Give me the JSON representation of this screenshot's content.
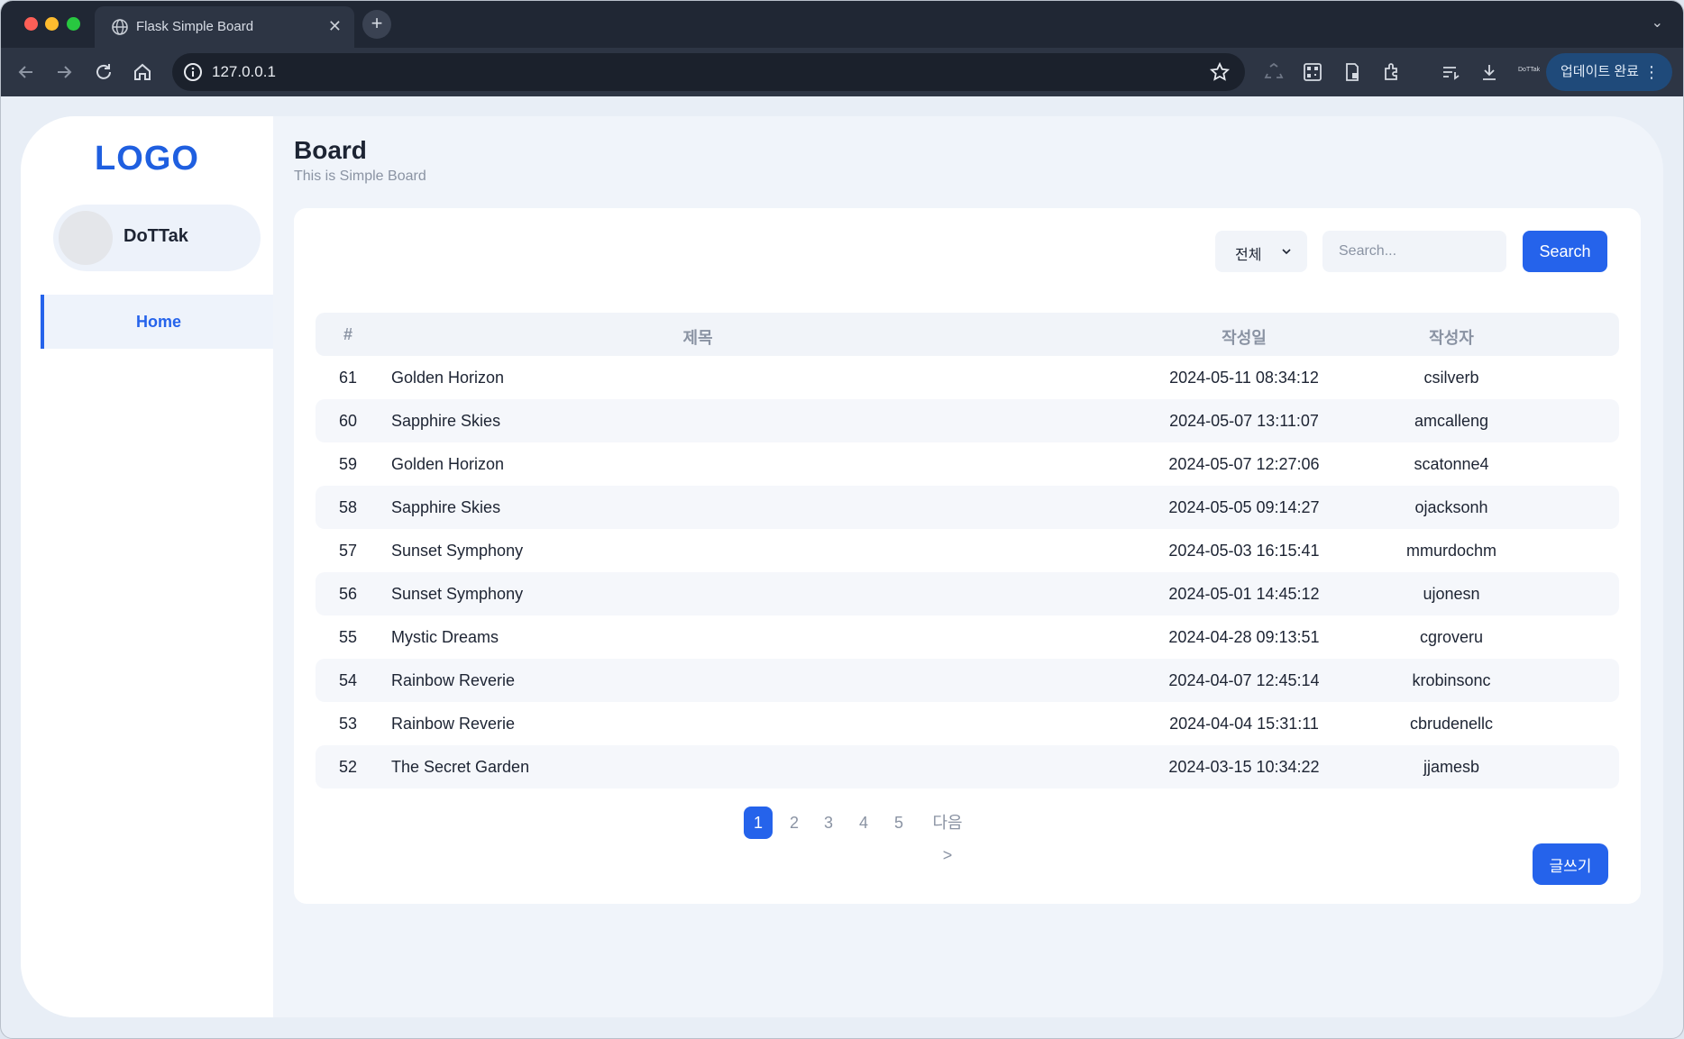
{
  "browser": {
    "tab_title": "Flask Simple Board",
    "url": "127.0.0.1",
    "update_label": "업데이트 완료",
    "extension_label": "DoTTak"
  },
  "sidebar": {
    "logo": "LOGO",
    "profile_name": "DoTTak",
    "nav": [
      {
        "label": "Home"
      }
    ]
  },
  "header": {
    "title": "Board",
    "subtitle": "This is Simple Board"
  },
  "filter": {
    "selected": "전체",
    "search_placeholder": "Search...",
    "search_label": "Search"
  },
  "table": {
    "columns": [
      "#",
      "제목",
      "작성일",
      "작성자"
    ],
    "rows": [
      {
        "num": "61",
        "title": "Golden Horizon",
        "date": "2024-05-11 08:34:12",
        "author": "csilverb"
      },
      {
        "num": "60",
        "title": "Sapphire Skies",
        "date": "2024-05-07 13:11:07",
        "author": "amcalleng"
      },
      {
        "num": "59",
        "title": "Golden Horizon",
        "date": "2024-05-07 12:27:06",
        "author": "scatonne4"
      },
      {
        "num": "58",
        "title": "Sapphire Skies",
        "date": "2024-05-05 09:14:27",
        "author": "ojacksonh"
      },
      {
        "num": "57",
        "title": "Sunset Symphony",
        "date": "2024-05-03 16:15:41",
        "author": "mmurdochm"
      },
      {
        "num": "56",
        "title": "Sunset Symphony",
        "date": "2024-05-01 14:45:12",
        "author": "ujonesn"
      },
      {
        "num": "55",
        "title": "Mystic Dreams",
        "date": "2024-04-28 09:13:51",
        "author": "cgroveru"
      },
      {
        "num": "54",
        "title": "Rainbow Reverie",
        "date": "2024-04-07 12:45:14",
        "author": "krobinsonc"
      },
      {
        "num": "53",
        "title": "Rainbow Reverie",
        "date": "2024-04-04 15:31:11",
        "author": "cbrudenellc"
      },
      {
        "num": "52",
        "title": "The Secret Garden",
        "date": "2024-03-15 10:34:22",
        "author": "jjamesb"
      }
    ]
  },
  "pagination": {
    "pages": [
      "1",
      "2",
      "3",
      "4",
      "5"
    ],
    "current": "1",
    "next_label": "다음 >"
  },
  "write_label": "글쓰기",
  "colors": {
    "accent": "#2563eb",
    "chrome_dark": "#202734",
    "page_bg": "#f0f4fa"
  },
  "icons": [
    "globe-icon",
    "close-icon",
    "plus-icon",
    "back-icon",
    "forward-icon",
    "reload-icon",
    "home-icon",
    "info-icon",
    "star-icon",
    "recycle-icon",
    "qr-icon",
    "document-icon",
    "puzzle-icon",
    "queue-icon",
    "download-icon",
    "more-icon",
    "chevron-down-icon"
  ]
}
